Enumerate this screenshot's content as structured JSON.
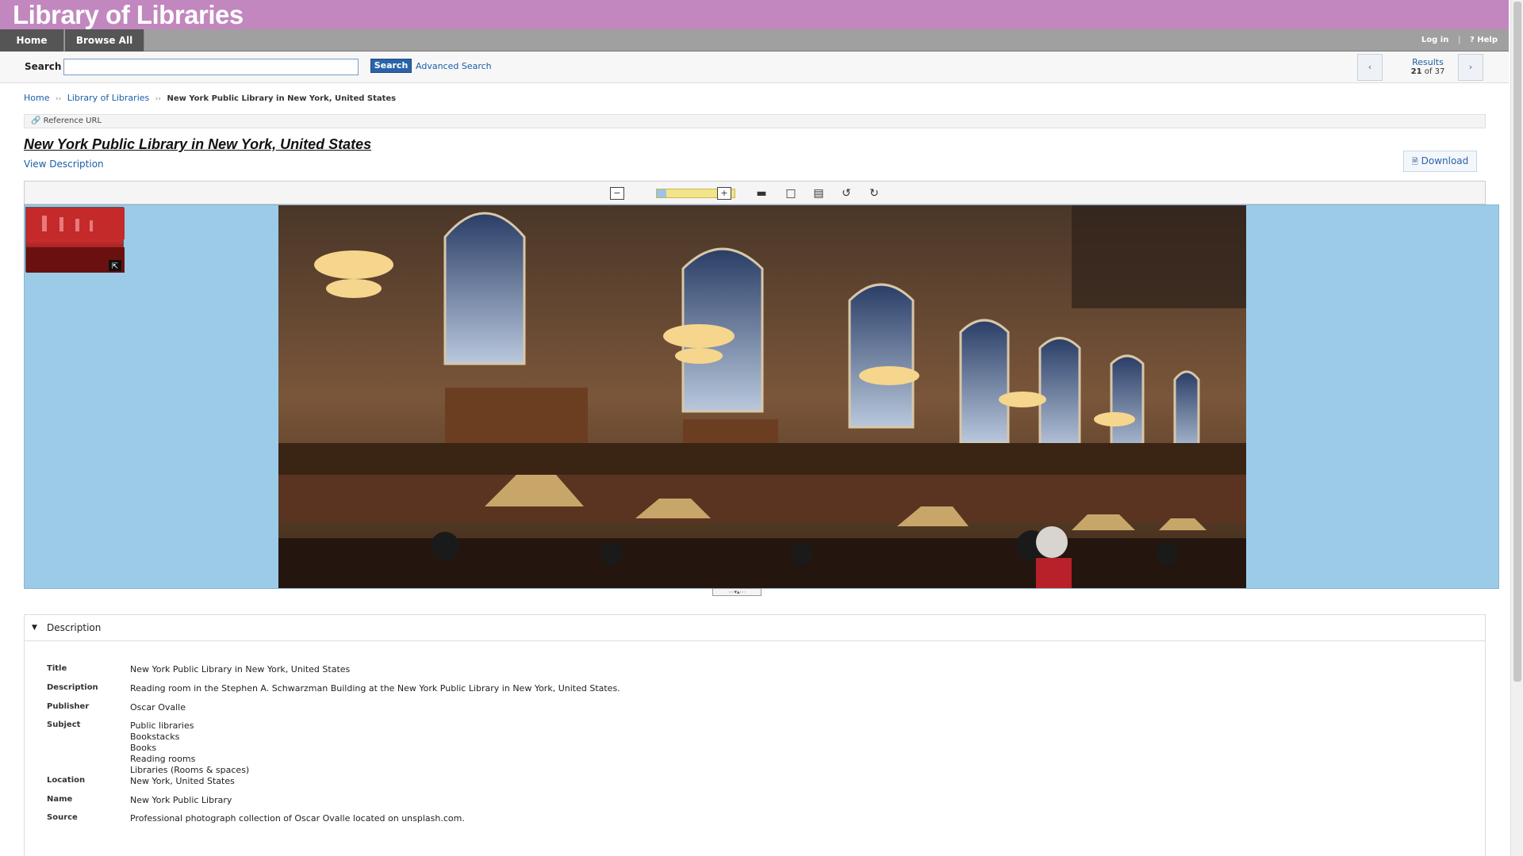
{
  "site": {
    "title": "Library of Libraries"
  },
  "nav": {
    "home": "Home",
    "browse_all": "Browse All",
    "login": "Log in",
    "help": "? Help"
  },
  "search": {
    "label": "Search",
    "value": "",
    "button": "Search",
    "advanced": "Advanced Search",
    "results_label": "Results",
    "results_current": "21",
    "results_of": "of 37"
  },
  "breadcrumb": {
    "home": "Home",
    "collection": "Library of Libraries",
    "current": "New York Public Library in New York, United States"
  },
  "reference_url": "Reference URL",
  "item": {
    "title": "New York Public Library in New York, United States",
    "view_description": "View Description",
    "download": "Download"
  },
  "viewer": {
    "zoom_fraction": 0.12,
    "image_name": "New York Public Library reading room"
  },
  "description": {
    "header": "Description",
    "rows": [
      {
        "key": "Title",
        "value": "New York Public Library in New York, United States"
      },
      {
        "key": "Description",
        "value": "Reading room in the Stephen A. Schwarzman Building at the New York Public Library in New York, United States."
      },
      {
        "key": "Publisher",
        "value": "Oscar Ovalle"
      },
      {
        "key": "Subject",
        "lines": [
          "Public libraries",
          "Bookstacks",
          "Books",
          "Reading rooms",
          "Libraries (Rooms & spaces)"
        ]
      },
      {
        "key": "Location",
        "value": "New York, United States"
      },
      {
        "key": "Name",
        "value": "New York Public Library"
      },
      {
        "key": "Source",
        "value": "Professional photograph collection of Oscar Ovalle located on unsplash.com."
      }
    ]
  },
  "colors": {
    "banner": "#c187be",
    "viewer_bg": "#9ccbe8",
    "link": "#1a5fa8",
    "search_button": "#2a63a8"
  }
}
